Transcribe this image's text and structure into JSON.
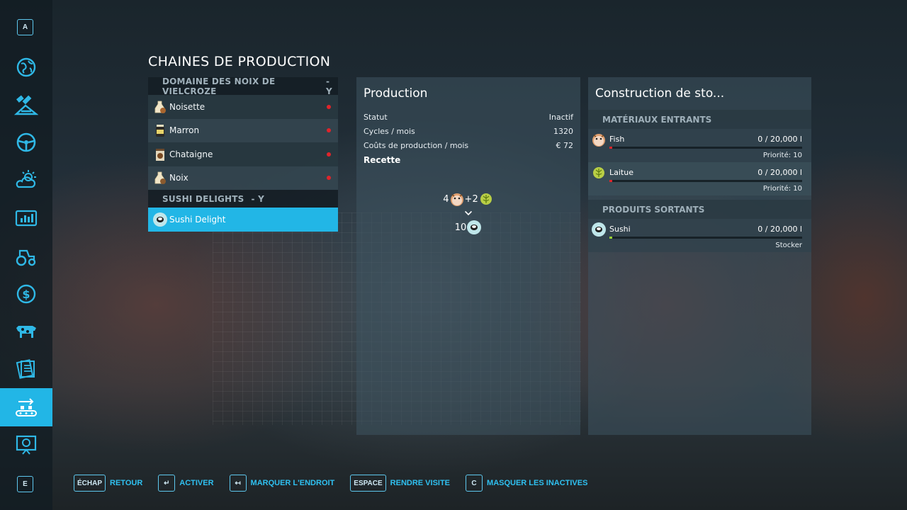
{
  "sidebar": {
    "top_key": "A",
    "bottom_key": "E",
    "items": [
      {
        "icon": "globe-icon"
      },
      {
        "icon": "satellite-icon"
      },
      {
        "icon": "steering-wheel-icon"
      },
      {
        "icon": "weather-icon"
      },
      {
        "icon": "statistics-icon"
      },
      {
        "icon": "tractor-icon"
      },
      {
        "icon": "dollar-icon"
      },
      {
        "icon": "cow-icon"
      },
      {
        "icon": "contracts-icon"
      },
      {
        "icon": "production-chain-icon",
        "active": true
      },
      {
        "icon": "presentation-icon"
      }
    ],
    "active_color": "#22b6e6"
  },
  "page": {
    "title": "CHAINES DE PRODUCTION"
  },
  "chains": {
    "groups": [
      {
        "name": "DOMAINE DES NOIX DE VIELCROZE",
        "suffix": "- Y",
        "items": [
          {
            "label": "Noisette",
            "icon": "hazelnut-oil-icon",
            "status": "inactive"
          },
          {
            "label": "Marron",
            "icon": "chestnut-jar-icon",
            "status": "inactive"
          },
          {
            "label": "Chataigne",
            "icon": "chestnut-box-icon",
            "status": "inactive"
          },
          {
            "label": "Noix",
            "icon": "walnut-oil-icon",
            "status": "inactive"
          }
        ]
      },
      {
        "name": "SUSHI DELIGHTS",
        "suffix": "- Y",
        "items": [
          {
            "label": "Sushi Delight",
            "icon": "sushi-icon",
            "selected": true
          }
        ]
      }
    ],
    "status_color": "#e0242b"
  },
  "production": {
    "title": "Production",
    "rows": [
      {
        "label": "Statut",
        "value": "Inactif"
      },
      {
        "label": "Cycles / mois",
        "value": "1320"
      },
      {
        "label": "Coûts de production / mois",
        "value": "€ 72"
      }
    ],
    "recipe_label": "Recette",
    "recipe": {
      "inputs": [
        {
          "amount": "4",
          "icon": "fish-icon"
        },
        {
          "amount": "+2",
          "icon": "lettuce-icon"
        }
      ],
      "output": {
        "amount": "10",
        "icon": "sushi-icon"
      }
    }
  },
  "storage": {
    "title": "Construction de sto...",
    "inputs_header": "MATÉRIAUX ENTRANTS",
    "inputs": [
      {
        "name": "Fish",
        "icon": "fish-icon",
        "value": "0  / 20,000 l",
        "note": "Priorité: 10",
        "fill_color": "#e0242b"
      },
      {
        "name": "Laitue",
        "icon": "lettuce-icon",
        "value": "0  / 20,000 l",
        "note": "Priorité: 10",
        "fill_color": "#e0242b"
      }
    ],
    "outputs_header": "PRODUITS SORTANTS",
    "outputs": [
      {
        "name": "Sushi",
        "icon": "sushi-icon",
        "value": "0  / 20,000 l",
        "note": "Stocker",
        "fill_color": "#9ad334"
      }
    ]
  },
  "footer": [
    {
      "key": "ÉCHAP",
      "label": "RETOUR"
    },
    {
      "key": "↵",
      "label": "ACTIVER"
    },
    {
      "key": "↤",
      "label": "MARQUER L'ENDROIT"
    },
    {
      "key": "ESPACE",
      "label": "RENDRE VISITE"
    },
    {
      "key": "C",
      "label": "MASQUER LES INACTIVES"
    }
  ]
}
